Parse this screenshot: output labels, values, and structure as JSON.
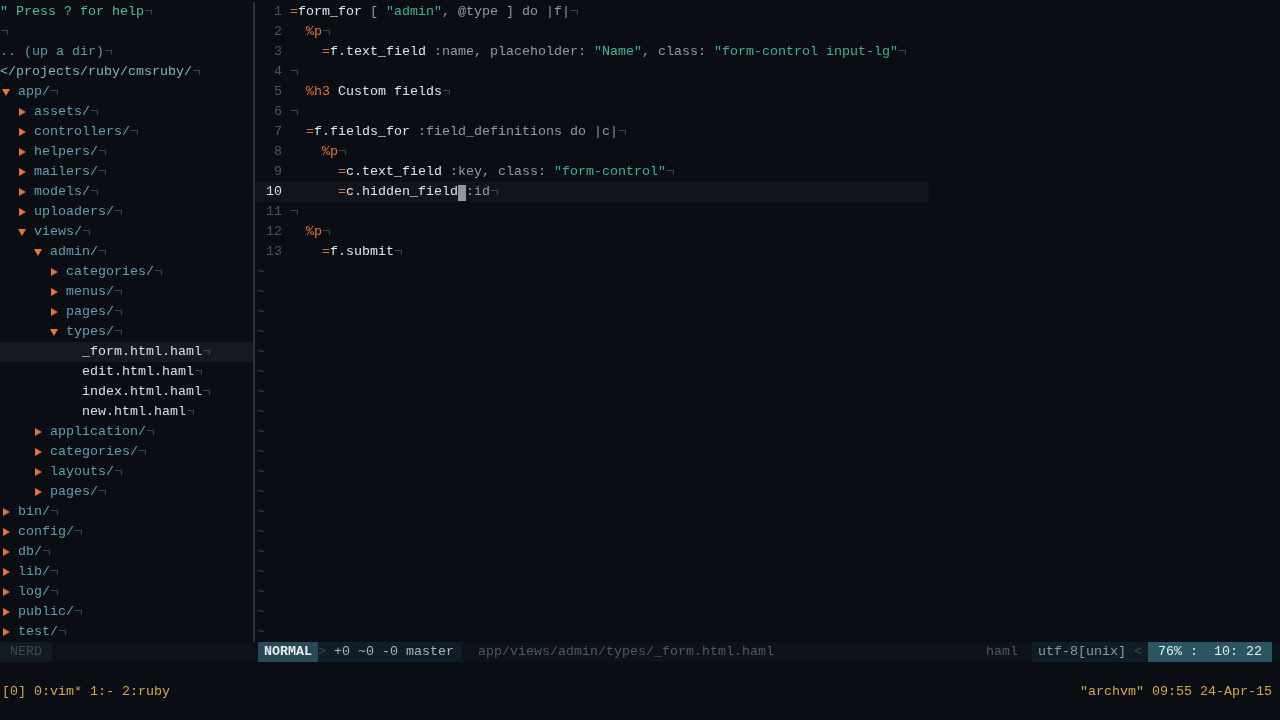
{
  "file_tree": {
    "help": "\" Press ? for help",
    "up_dir": ".. (up a dir)",
    "root": "</projects/ruby/cmsruby/",
    "items": [
      {
        "name": "app/",
        "kind": "dir",
        "expanded": true,
        "selected": false,
        "children": [
          {
            "name": "assets/",
            "kind": "dir",
            "expanded": false,
            "selected": false
          },
          {
            "name": "controllers/",
            "kind": "dir",
            "expanded": false,
            "selected": false
          },
          {
            "name": "helpers/",
            "kind": "dir",
            "expanded": false,
            "selected": false
          },
          {
            "name": "mailers/",
            "kind": "dir",
            "expanded": false,
            "selected": false
          },
          {
            "name": "models/",
            "kind": "dir",
            "expanded": false,
            "selected": false
          },
          {
            "name": "uploaders/",
            "kind": "dir",
            "expanded": false,
            "selected": false
          },
          {
            "name": "views/",
            "kind": "dir",
            "expanded": true,
            "selected": false,
            "children": [
              {
                "name": "admin/",
                "kind": "dir",
                "expanded": true,
                "selected": false,
                "children": [
                  {
                    "name": "categories/",
                    "kind": "dir",
                    "expanded": false,
                    "selected": false
                  },
                  {
                    "name": "menus/",
                    "kind": "dir",
                    "expanded": false,
                    "selected": false
                  },
                  {
                    "name": "pages/",
                    "kind": "dir",
                    "expanded": false,
                    "selected": false
                  },
                  {
                    "name": "types/",
                    "kind": "dir",
                    "expanded": true,
                    "selected": false,
                    "children": [
                      {
                        "name": "_form.html.haml",
                        "kind": "file",
                        "selected": true
                      },
                      {
                        "name": "edit.html.haml",
                        "kind": "file",
                        "selected": false
                      },
                      {
                        "name": "index.html.haml",
                        "kind": "file",
                        "selected": false
                      },
                      {
                        "name": "new.html.haml",
                        "kind": "file",
                        "selected": false
                      }
                    ]
                  }
                ]
              },
              {
                "name": "application/",
                "kind": "dir",
                "expanded": false,
                "selected": false
              },
              {
                "name": "categories/",
                "kind": "dir",
                "expanded": false,
                "selected": false
              },
              {
                "name": "layouts/",
                "kind": "dir",
                "expanded": false,
                "selected": false
              },
              {
                "name": "pages/",
                "kind": "dir",
                "expanded": false,
                "selected": false
              }
            ]
          }
        ]
      },
      {
        "name": "bin/",
        "kind": "dir",
        "expanded": false,
        "selected": false
      },
      {
        "name": "config/",
        "kind": "dir",
        "expanded": false,
        "selected": false
      },
      {
        "name": "db/",
        "kind": "dir",
        "expanded": false,
        "selected": false
      },
      {
        "name": "lib/",
        "kind": "dir",
        "expanded": false,
        "selected": false
      },
      {
        "name": "log/",
        "kind": "dir",
        "expanded": false,
        "selected": false
      },
      {
        "name": "public/",
        "kind": "dir",
        "expanded": false,
        "selected": false
      },
      {
        "name": "test/",
        "kind": "dir",
        "expanded": false,
        "selected": false
      }
    ]
  },
  "editor": {
    "lines": [
      {
        "number": "1",
        "current": false,
        "tokens": [
          {
            "kind": "op",
            "text": "="
          },
          {
            "kind": "ident",
            "text": "form_for"
          },
          {
            "kind": "plain",
            "text": " [ "
          },
          {
            "kind": "string",
            "text": "\"admin\""
          },
          {
            "kind": "plain",
            "text": ", @type ] do |f|"
          }
        ]
      },
      {
        "number": "2",
        "current": false,
        "tokens": [
          {
            "kind": "op",
            "text": "  %p"
          }
        ]
      },
      {
        "number": "3",
        "current": false,
        "tokens": [
          {
            "kind": "op",
            "text": "    ="
          },
          {
            "kind": "ident",
            "text": "f.text_field"
          },
          {
            "kind": "plain",
            "text": " :name, placeholder: "
          },
          {
            "kind": "string",
            "text": "\"Name\""
          },
          {
            "kind": "plain",
            "text": ", class: "
          },
          {
            "kind": "string",
            "text": "\"form-control input-lg\""
          }
        ]
      },
      {
        "number": "4",
        "current": false
      },
      {
        "number": "5",
        "current": false,
        "tokens": [
          {
            "kind": "op",
            "text": "  %h3"
          },
          {
            "kind": "ident",
            "text": " Custom fields"
          }
        ]
      },
      {
        "number": "6",
        "current": false
      },
      {
        "number": "7",
        "current": false,
        "tokens": [
          {
            "kind": "op",
            "text": "  ="
          },
          {
            "kind": "ident",
            "text": "f.fields_for"
          },
          {
            "kind": "plain",
            "text": " :field_definitions do |c|"
          }
        ]
      },
      {
        "number": "8",
        "current": false,
        "tokens": [
          {
            "kind": "op",
            "text": "    %p"
          }
        ]
      },
      {
        "number": "9",
        "current": false,
        "tokens": [
          {
            "kind": "op",
            "text": "      ="
          },
          {
            "kind": "ident",
            "text": "c.text_field"
          },
          {
            "kind": "plain",
            "text": " :key, class: "
          },
          {
            "kind": "string",
            "text": "\"form-control\""
          }
        ]
      },
      {
        "number": "10",
        "current": true,
        "tokens": [
          {
            "kind": "op",
            "text": "      ="
          },
          {
            "kind": "ident",
            "text": "c.hidden_field"
          },
          {
            "kind": "plain",
            "text": " :id",
            "cursor": true
          }
        ]
      },
      {
        "number": "11",
        "current": false
      },
      {
        "number": "12",
        "current": false,
        "tokens": [
          {
            "kind": "op",
            "text": "  %p"
          }
        ]
      },
      {
        "number": "13",
        "current": false,
        "tokens": [
          {
            "kind": "op",
            "text": "    ="
          },
          {
            "kind": "ident",
            "text": "f.submit"
          }
        ]
      }
    ],
    "filler": [
      "~",
      "~",
      "~",
      "~",
      "~",
      "~",
      "~",
      "~",
      "~",
      "~",
      "~",
      "~",
      "~",
      "~",
      "~",
      "~",
      "~",
      "~",
      "~"
    ]
  },
  "status_line": {
    "tree_label": "NERD",
    "mode": "NORMAL",
    "separator_left": ">",
    "git": "+0 ~0 -0 master",
    "path": "app/views/admin/types/_form.html.haml",
    "filetype": "haml",
    "encoding": "utf-8[unix]",
    "separator_right": "<",
    "position": "76% :  10: 22"
  },
  "tmux": {
    "windows": "[0] 0:vim* 1:- 2:ruby",
    "host_clock": "\"archvm\" 09:55 24-Apr-15"
  }
}
